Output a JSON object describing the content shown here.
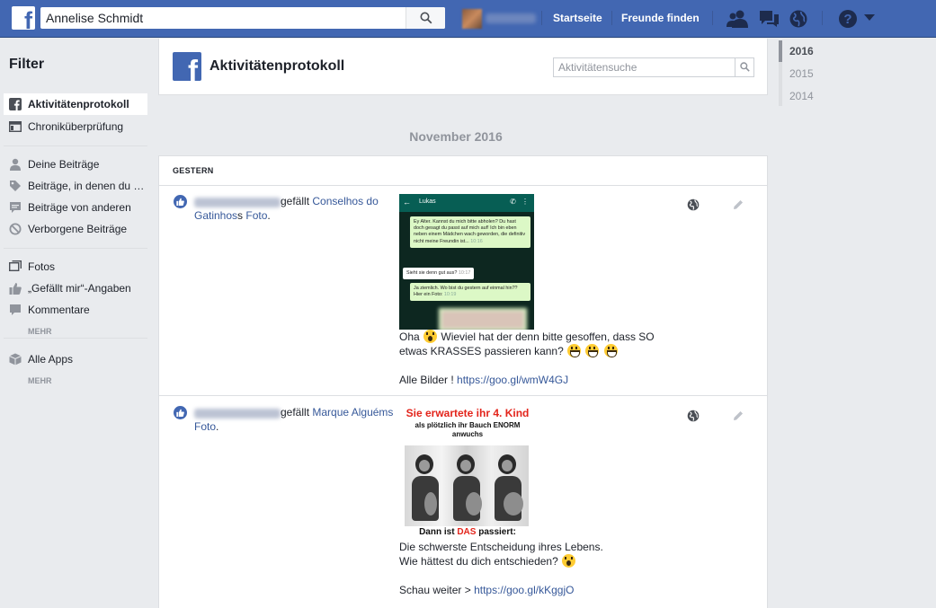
{
  "topbar": {
    "search_value": "Annelise Schmidt",
    "nav": [
      "Startseite",
      "Freunde finden"
    ]
  },
  "sidebar": {
    "title": "Filter",
    "items": [
      {
        "label": "Aktivitätenprotokoll",
        "icon": "facebook-icon",
        "active": true
      },
      {
        "label": "Chroniküberprüfung",
        "icon": "timeline-review-icon"
      },
      {
        "label": "Deine Beiträge",
        "icon": "person-icon"
      },
      {
        "label": "Beiträge, in denen du markiert wurdest",
        "icon": "tag-icon"
      },
      {
        "label": "Beiträge von anderen",
        "icon": "comment-icon"
      },
      {
        "label": "Verborgene Beiträge",
        "icon": "hidden-icon"
      },
      {
        "label": "Fotos",
        "icon": "photos-icon"
      },
      {
        "label": "„Gefällt mir“-Angaben",
        "icon": "thumbs-up-icon"
      },
      {
        "label": "Kommentare",
        "icon": "comment-icon"
      },
      {
        "label": "Alle Apps",
        "icon": "apps-box-icon"
      }
    ],
    "more_label": "MEHR"
  },
  "header": {
    "title": "Aktivitätenprotokoll",
    "search_placeholder": "Aktivitätensuche"
  },
  "month_label": "November 2016",
  "day_label": "GESTERN",
  "entries": [
    {
      "action": "gefällt",
      "target_link": "Conselhos do Gatinhos",
      "object_link": "Foto",
      "post_line1": "Oha",
      "post_line1b": "Wieviel hat der denn bitte gesoffen, dass SO",
      "post_line2": "etwas KRASSES passieren kann?",
      "post_line3_prefix": "Alle Bilder !",
      "post_link": "https://goo.gl/wmW4GJ",
      "chat": {
        "contact": "Lukas",
        "msg1": "Ey Alter. Kannst du mich bitte abholen? Du hast doch gesagt du passt auf mich auf! Ich bin eben neben einem Mädchen wach geworden, die definitiv nicht meine Freundin ist...",
        "msg1_time": "10:16",
        "msg2": "Sieht sie denn gut aus?",
        "msg2_time": "10:17",
        "msg3": "Ja ziemlich. Wo bist du gestern auf einmal hin?? Hier ein Foto:",
        "msg3_time": "10:19"
      }
    },
    {
      "action": "gefällt",
      "target_link": "Marque Alguéms",
      "object_link": "Foto",
      "post_line1": "Die schwerste Entscheidung ihres Lebens.",
      "post_line2": "Wie hättest du dich entschieden?",
      "post_line3_prefix": "Schau weiter >",
      "post_link": "https://goo.gl/kKggjO",
      "image": {
        "headline": "Sie erwartete ihr 4. Kind",
        "subline": "als plötzlich ihr Bauch ENORM anwuchs",
        "footer_pre": "Dann ist",
        "footer_red": "DAS",
        "footer_post": "passiert:"
      }
    }
  ],
  "years": [
    "2016",
    "2015",
    "2014"
  ]
}
